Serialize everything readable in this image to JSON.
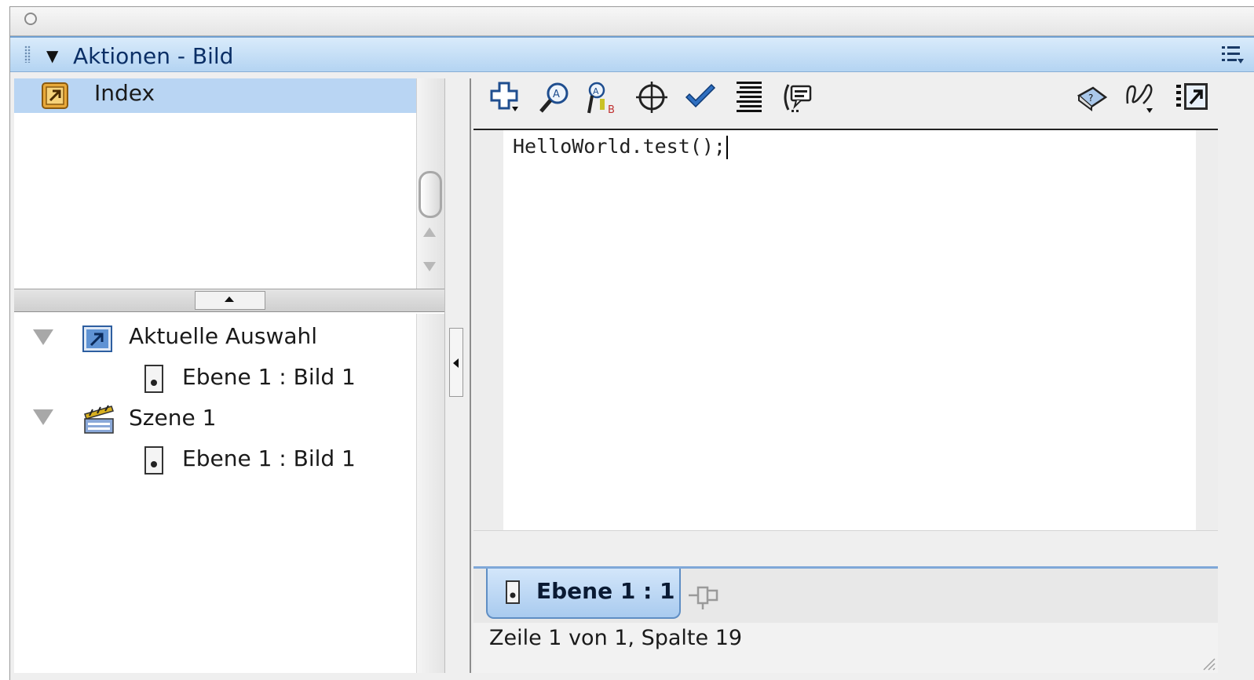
{
  "window": {
    "close_glyph": "○"
  },
  "panel": {
    "collapse_glyph": "▼",
    "title": "Aktionen - Bild"
  },
  "left": {
    "index_label": "Index",
    "tree": [
      {
        "label": "Aktuelle Auswahl",
        "icon": "current-selection-icon"
      },
      {
        "label": "Ebene 1 : Bild 1",
        "icon": "frame-doc-icon"
      },
      {
        "label": "Szene 1",
        "icon": "clapperboard-icon"
      },
      {
        "label": "Ebene 1 : Bild 1",
        "icon": "frame-doc-icon"
      }
    ]
  },
  "toolbar": {
    "buttons": [
      "add-statement-icon",
      "find-icon",
      "replace-icon",
      "target-path-icon",
      "check-syntax-icon",
      "auto-format-icon",
      "code-hint-icon",
      "reference-icon",
      "debug-options-icon",
      "script-assist-icon"
    ]
  },
  "editor": {
    "code": "HelloWorld.test();"
  },
  "tab": {
    "label": "Ebene 1 : 1"
  },
  "status": {
    "text": "Zeile 1 von 1, Spalte 19"
  },
  "colors": {
    "header_blue": "#b4d4f2",
    "selection_blue": "#b9d5f3",
    "tab_blue": "#a9cbef"
  }
}
